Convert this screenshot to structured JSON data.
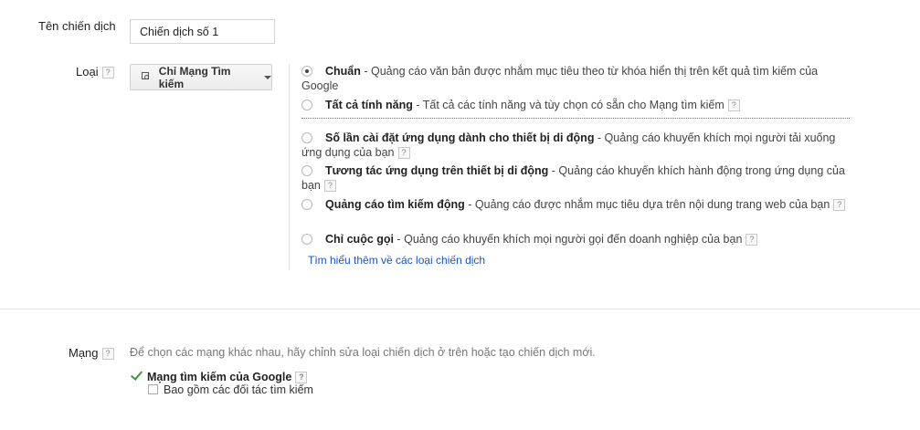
{
  "campaign_name": {
    "label": "Tên chiến dịch",
    "value": "Chiến dịch số 1"
  },
  "type": {
    "label": "Loại",
    "help": "?",
    "dropdown_label": "Chỉ Mạng Tìm kiếm",
    "options": [
      {
        "title": "Chuẩn",
        "desc": " - Quảng cáo văn bản được nhắm mục tiêu theo từ khóa hiển thị trên kết quả tìm kiếm của Google",
        "selected": true
      },
      {
        "title": "Tất cả tính năng",
        "desc": " - Tất cả các tính năng và tùy chọn có sẵn cho Mạng tìm kiếm",
        "selected": false
      },
      {
        "title": "Số lần cài đặt ứng dụng dành cho thiết bị di động",
        "desc": " - Quảng cáo khuyến khích mọi người tải xuống ứng dụng của bạn",
        "selected": false
      },
      {
        "title": "Tương tác ứng dụng trên thiết bị di động",
        "desc": " - Quảng cáo khuyến khích hành động trong ứng dụng của bạn",
        "selected": false
      },
      {
        "title": "Quảng cáo tìm kiếm động",
        "desc": " - Quảng cáo được nhắm mục tiêu dựa trên nội dung trang web của bạn",
        "selected": false
      },
      {
        "title": "Chỉ cuộc gọi",
        "desc": " - Quảng cáo khuyến khích mọi người gọi đến doanh nghiệp của bạn",
        "selected": false
      }
    ],
    "learn_more": "Tìm hiểu thêm về các loại chiến dịch"
  },
  "network": {
    "label": "Mạng",
    "help": "?",
    "note": "Để chọn các mạng khác nhau, hãy chỉnh sửa loại chiến dịch ở trên hoặc tạo chiến dịch mới.",
    "selected_network": "Mạng tìm kiếm của Google",
    "partners_label": "Bao gồm các đối tác tìm kiếm",
    "partners_checked": false
  }
}
